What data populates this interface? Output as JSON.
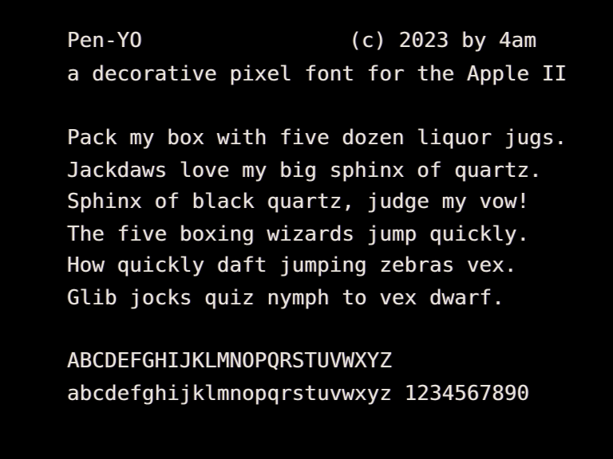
{
  "screen": {
    "title": "Pen-YO",
    "copyright": "(c) 2023 by 4am",
    "subtitle": "a decorative pixel font for the Apple II",
    "pangrams": [
      "Pack my box with five dozen liquor jugs.",
      "Jackdaws love my big sphinx of quartz.",
      "Sphinx of black quartz, judge my vow!",
      "The five boxing wizards jump quickly.",
      "How quickly daft jumping zebras vex.",
      "Glib jocks quiz nymph to vex dwarf."
    ],
    "uppercase_sample": "ABCDEFGHIJKLMNOPQRSTUVWXYZ",
    "lowercase_sample": "abcdefghijklmnopqrstuvwxyz 1234567890"
  },
  "colors": {
    "background": "#000000",
    "text": "#e8e4dc"
  }
}
